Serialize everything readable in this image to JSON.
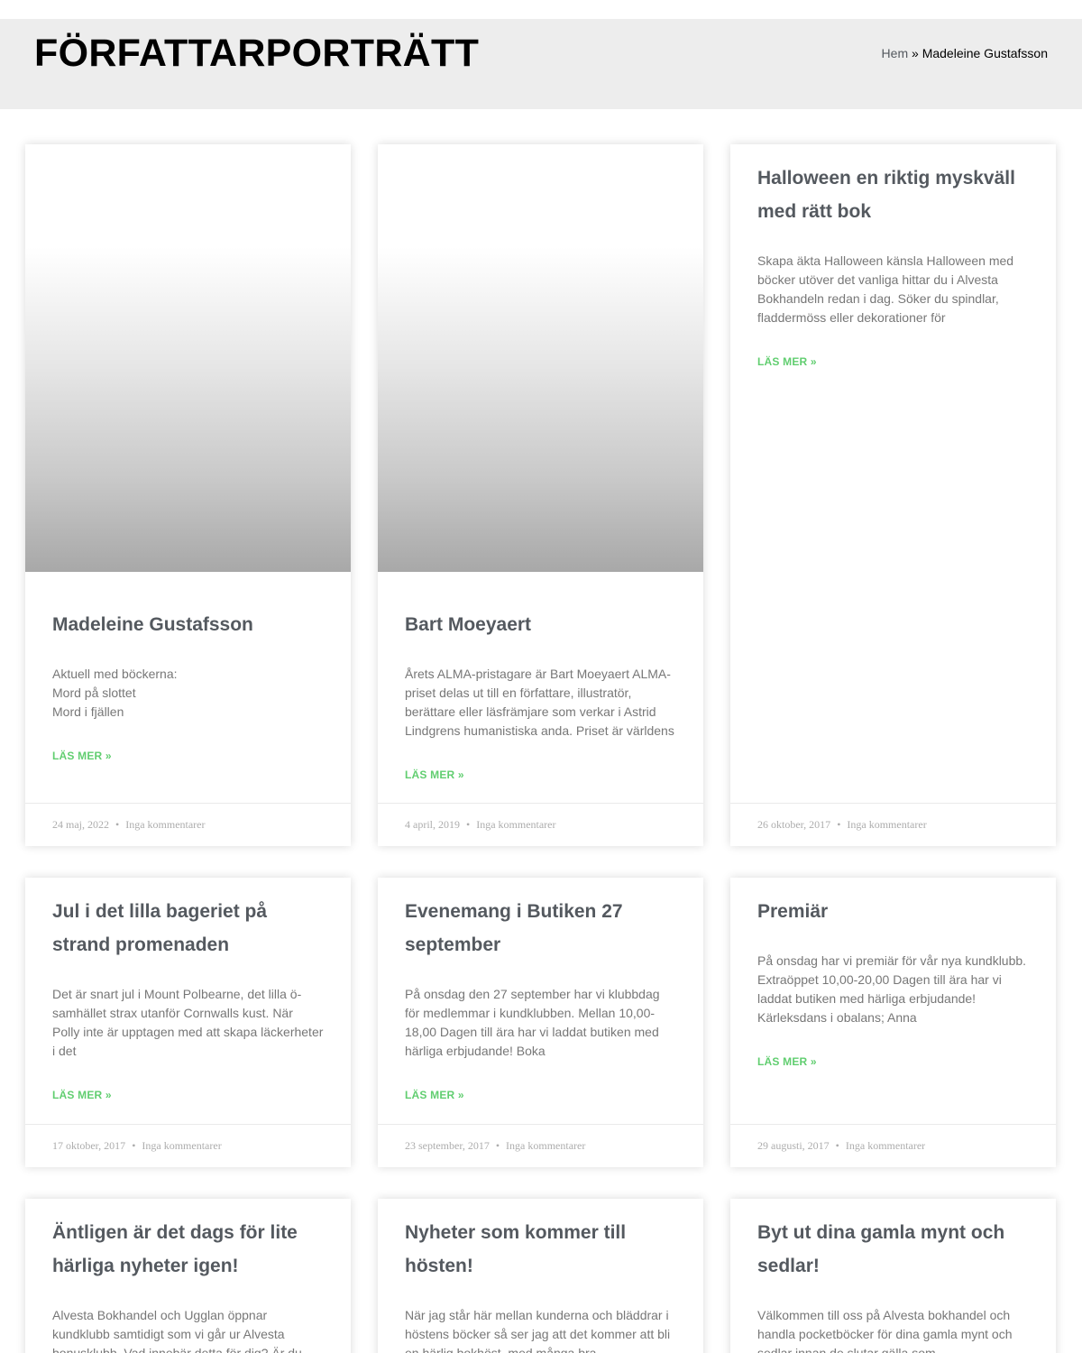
{
  "header": {
    "title": "FÖRFATTARPORTRÄTT",
    "breadcrumb": {
      "home": "Hem",
      "separator": "»",
      "current": "Madeleine Gustafsson"
    }
  },
  "colors": {
    "accent": "#61ce70",
    "header_bg": "#ededed",
    "title": "#54595f",
    "meta": "#adadad"
  },
  "posts": [
    {
      "title": "Madeleine Gustafsson",
      "excerpt": "Aktuell med böckerna:\nMord på slottet\nMord i fjällen",
      "read_more": "LÄS MER »",
      "date": "24 maj, 2022",
      "comments": "Inga kommentarer"
    },
    {
      "title": "Bart Moeyaert",
      "excerpt": "Årets ALMA-pristagare är Bart Moeyaert ALMA-priset delas ut till en författare, illustratör, berättare eller läsfrämjare som verkar i Astrid Lindgrens humanistiska anda. Priset är världens",
      "read_more": "LÄS MER »",
      "date": "4 april, 2019",
      "comments": "Inga kommentarer"
    },
    {
      "title": "Halloween en riktig myskväll med rätt bok",
      "excerpt": "Skapa äkta Halloween känsla  Halloween med böcker utöver det vanliga hittar du i Alvesta Bokhandeln redan i dag. Söker du spindlar, fladdermöss eller dekorationer för",
      "read_more": "LÄS MER »",
      "date": "26 oktober, 2017",
      "comments": "Inga kommentarer"
    },
    {
      "title": "Jul i det lilla bageriet på strand promenaden",
      "excerpt": "Det är snart jul i Mount Polbearne, det lilla ö-samhället strax utanför Cornwalls kust. När Polly inte är upptagen med att skapa läckerheter i det",
      "read_more": "LÄS MER »",
      "date": "17 oktober, 2017",
      "comments": "Inga kommentarer"
    },
    {
      "title": "Evenemang i Butiken 27 september",
      "excerpt": "På onsdag den 27 september har vi klubbdag för medlemmar i  kundklubben. Mellan  10,00-18,00 Dagen till ära har vi laddat butiken med härliga erbjudande! Boka",
      "read_more": "LÄS MER »",
      "date": "23 september, 2017",
      "comments": "Inga kommentarer"
    },
    {
      "title": "Premiär",
      "excerpt": "På onsdag har vi premiär för vår nya kundklubb. Extraöppet 10,00-20,00 Dagen till ära har vi laddat butiken med härliga erbjudande! Kärleksdans i obalans; Anna",
      "read_more": "LÄS MER »",
      "date": "29 augusti, 2017",
      "comments": "Inga kommentarer"
    },
    {
      "title": "Äntligen är det dags för lite härliga nyheter igen!",
      "excerpt": "Alvesta Bokhandel och Ugglan öppnar kundklubb samtidigt som vi går ur Alvesta bonusklubb. Vad innebär detta för dig? Är du",
      "read_more": "",
      "date": "",
      "comments": ""
    },
    {
      "title": "Nyheter som kommer till hösten!",
      "excerpt": "När jag står här mellan kunderna och bläddrar i höstens böcker så ser jag att det kommer att bli en härlig bokhöst, med många bra",
      "read_more": "",
      "date": "",
      "comments": ""
    },
    {
      "title": "Byt ut dina gamla mynt och sedlar!",
      "excerpt": "Välkommen till oss på Alvesta bokhandel och handla pocketböcker för dina gamla mynt och sedlar innan de slutar gälla som",
      "read_more": "",
      "date": "",
      "comments": ""
    }
  ]
}
